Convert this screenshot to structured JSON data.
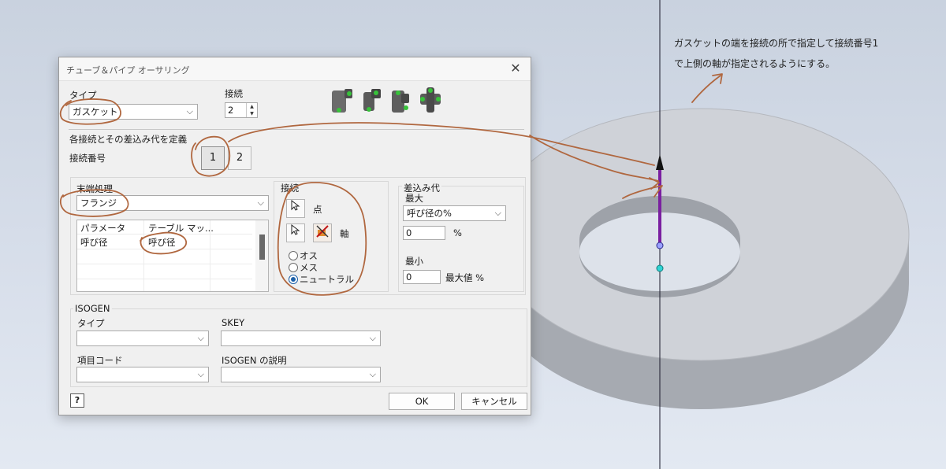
{
  "annotation": {
    "line1": "ガスケットの端を接続の所で指定して接続番号1",
    "line2": "で上側の軸が指定されるようにする。"
  },
  "dialog": {
    "title": "チューブ＆パイプ オーサリング",
    "close_glyph": "✕",
    "type_label": "タイプ",
    "type_value": "ガスケット",
    "connections_label": "接続",
    "connections_value": "2",
    "define_section_label": "各接続とその差込み代を定義",
    "connection_number_label": "接続番号",
    "connection_number_buttons": [
      "1",
      "2"
    ],
    "end_treatment_label": "末端処理",
    "end_treatment_value": "フランジ",
    "params_table": {
      "headers": [
        "パラメータ",
        "テーブル マッ..."
      ],
      "rows": [
        [
          "呼び径",
          "呼び径"
        ]
      ]
    },
    "connection_group_label": "接続",
    "point_label": "点",
    "axis_label": "軸",
    "gender_options": [
      "オス",
      "メス",
      "ニュートラル"
    ],
    "gender_selected": "ニュートラル",
    "engagement_group_label": "差込み代",
    "max_label": "最大",
    "max_mode_value": "呼び径の%",
    "max_value": "0",
    "max_unit": "%",
    "min_label": "最小",
    "min_value": "0",
    "min_unit": "最大値 %",
    "isogen_group_label": "ISOGEN",
    "isogen_type_label": "タイプ",
    "skey_label": "SKEY",
    "item_code_label": "項目コード",
    "isogen_desc_label": "ISOGEN の説明",
    "ok_label": "OK",
    "cancel_label": "キャンセル",
    "help_glyph": "?"
  },
  "colors": {
    "connection_axis": "#7a1fa0",
    "scribble": "#b0673f",
    "point_marker": "#2fd4d4"
  },
  "icons": [
    "arrow-cursor-icon",
    "axis-select-icon",
    "fitting-type-icons"
  ]
}
